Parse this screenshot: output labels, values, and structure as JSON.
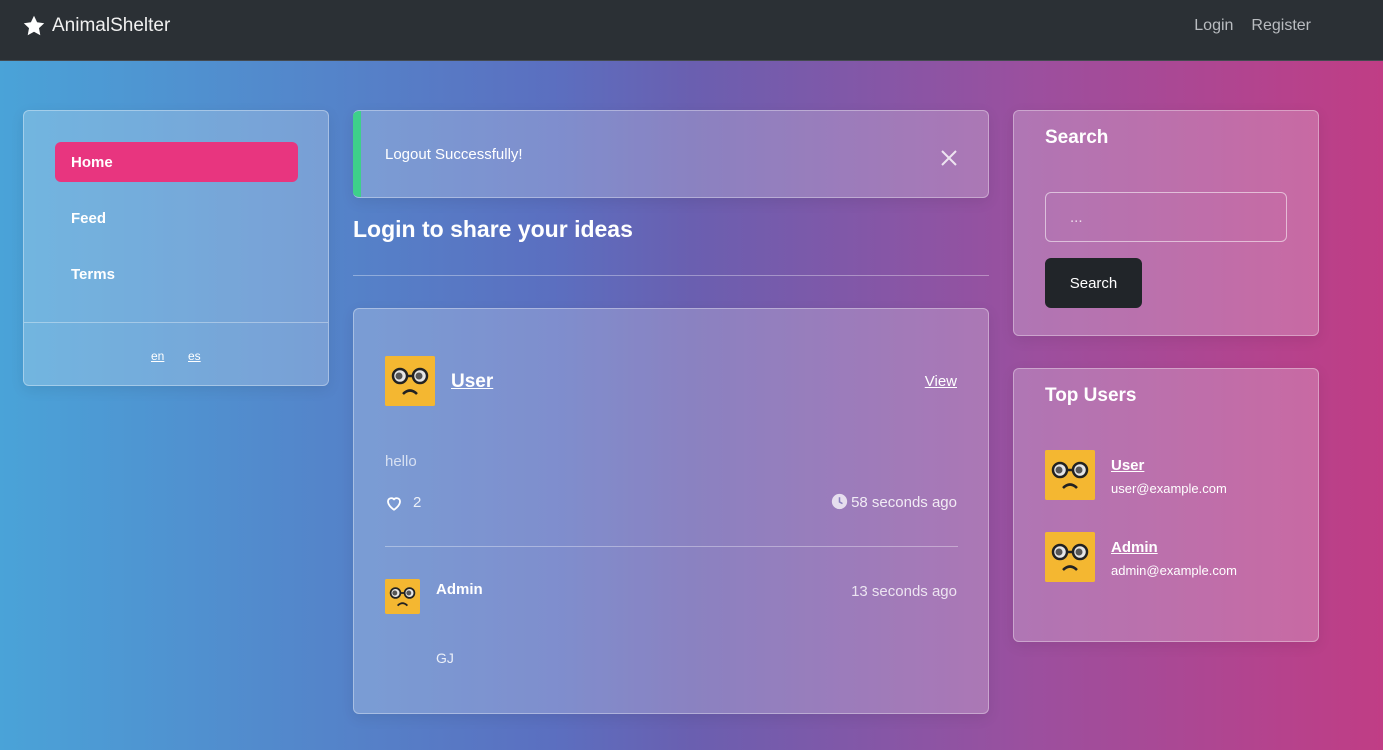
{
  "navbar": {
    "brand": "AnimalShelter",
    "login": "Login",
    "register": "Register"
  },
  "sidebar": {
    "items": [
      {
        "label": "Home",
        "active": true
      },
      {
        "label": "Feed"
      },
      {
        "label": "Terms"
      }
    ],
    "languages": [
      "en",
      "es"
    ]
  },
  "alert": {
    "message": "Logout Successfully!",
    "accent_color": "#3ed08a"
  },
  "main": {
    "share_title": "Login to share your ideas"
  },
  "post": {
    "author": "User",
    "view_label": "View",
    "body": "hello",
    "likes": "2",
    "time": "58 seconds ago",
    "comment": {
      "author": "Admin",
      "time": "13 seconds ago",
      "text": "GJ"
    }
  },
  "search": {
    "title": "Search",
    "placeholder": "...",
    "button": "Search"
  },
  "top_users": {
    "title": "Top Users",
    "users": [
      {
        "name": "User",
        "email": "user@example.com"
      },
      {
        "name": "Admin",
        "email": "admin@example.com"
      }
    ]
  },
  "colors": {
    "active_nav": "#e8357f",
    "avatar_bg": "#f4b731",
    "navbar_bg": "#2b3035"
  }
}
